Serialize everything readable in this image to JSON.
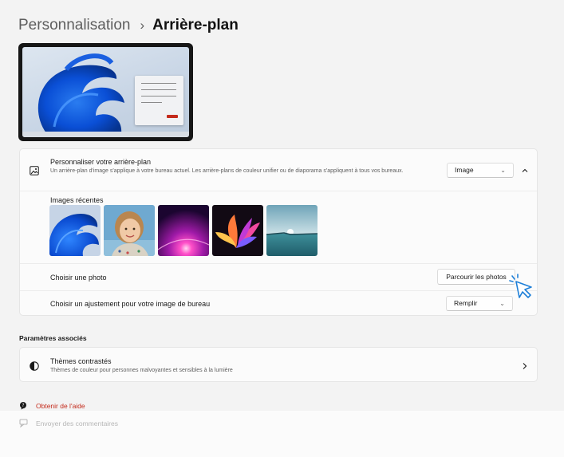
{
  "breadcrumb": {
    "parent": "Personnalisation",
    "separator": "›",
    "current": "Arrière-plan"
  },
  "background_card": {
    "title": "Personnaliser votre arrière-plan",
    "description": "Un arrière-plan d'image s'applique à votre bureau actuel. Les arrière-plans de couleur unifier ou de diaporama s'appliquent à tous vos bureaux.",
    "type_dropdown": "Image",
    "recent_images_label": "Images récentes",
    "recent_images": [
      "bloom-blue",
      "child-portrait",
      "purple-glow",
      "colorful-bloom",
      "lake-sunrise"
    ],
    "choose_photo_label": "Choisir une photo",
    "browse_button": "Parcourir les photos",
    "fit_label": "Choisir un ajustement pour votre image de bureau",
    "fit_dropdown": "Remplir"
  },
  "related": {
    "heading": "Paramètres associés",
    "contrast_title": "Thèmes contrastés",
    "contrast_desc": "Thèmes de couleur pour personnes malvoyantes et sensibles à la lumière"
  },
  "footer": {
    "help": "Obtenir de l'aide",
    "feedback": "Envoyer des commentaires"
  },
  "colors": {
    "accent": "#0067c0",
    "help_link": "#c42b1c",
    "background": "#f3f3f3",
    "card": "#fbfbfb"
  }
}
